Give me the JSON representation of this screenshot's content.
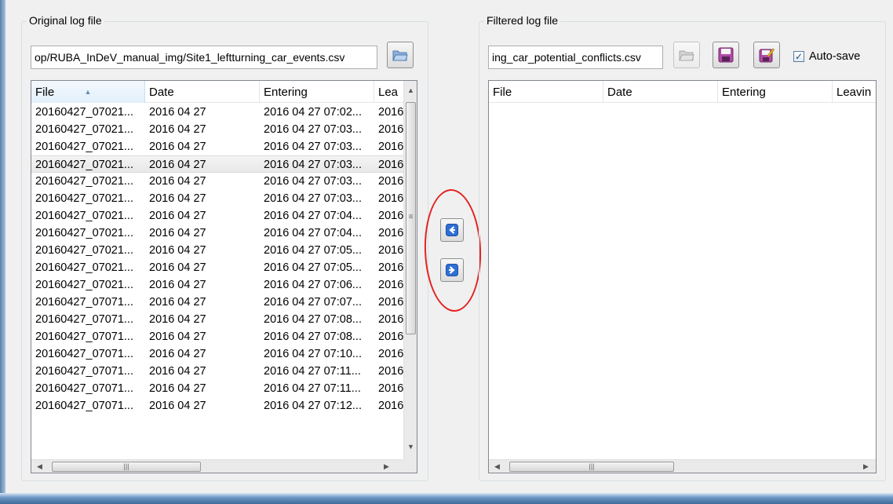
{
  "original": {
    "group_title": "Original log file",
    "path": "op/RUBA_InDeV_manual_img/Site1_leftturning_car_events.csv",
    "columns": [
      "File",
      "Date",
      "Entering",
      "Lea"
    ],
    "rows": [
      [
        "20160427_07021...",
        "2016 04 27",
        "2016 04 27 07:02...",
        "2016"
      ],
      [
        "20160427_07021...",
        "2016 04 27",
        "2016 04 27 07:03...",
        "2016"
      ],
      [
        "20160427_07021...",
        "2016 04 27",
        "2016 04 27 07:03...",
        "2016"
      ],
      [
        "20160427_07021...",
        "2016 04 27",
        "2016 04 27 07:03...",
        "2016"
      ],
      [
        "20160427_07021...",
        "2016 04 27",
        "2016 04 27 07:03...",
        "2016"
      ],
      [
        "20160427_07021...",
        "2016 04 27",
        "2016 04 27 07:03...",
        "2016"
      ],
      [
        "20160427_07021...",
        "2016 04 27",
        "2016 04 27 07:04...",
        "2016"
      ],
      [
        "20160427_07021...",
        "2016 04 27",
        "2016 04 27 07:04...",
        "2016"
      ],
      [
        "20160427_07021...",
        "2016 04 27",
        "2016 04 27 07:05...",
        "2016"
      ],
      [
        "20160427_07021...",
        "2016 04 27",
        "2016 04 27 07:05...",
        "2016"
      ],
      [
        "20160427_07021...",
        "2016 04 27",
        "2016 04 27 07:06...",
        "2016"
      ],
      [
        "20160427_07071...",
        "2016 04 27",
        "2016 04 27 07:07...",
        "2016"
      ],
      [
        "20160427_07071...",
        "2016 04 27",
        "2016 04 27 07:08...",
        "2016"
      ],
      [
        "20160427_07071...",
        "2016 04 27",
        "2016 04 27 07:08...",
        "2016"
      ],
      [
        "20160427_07071...",
        "2016 04 27",
        "2016 04 27 07:10...",
        "2016"
      ],
      [
        "20160427_07071...",
        "2016 04 27",
        "2016 04 27 07:11...",
        "2016"
      ],
      [
        "20160427_07071...",
        "2016 04 27",
        "2016 04 27 07:11...",
        "2016"
      ],
      [
        "20160427_07071...",
        "2016 04 27",
        "2016 04 27 07:12...",
        "2016"
      ]
    ],
    "hovered_row": 3,
    "sorted_column": 0
  },
  "filtered": {
    "group_title": "Filtered log file",
    "path": "ing_car_potential_conflicts.csv",
    "columns": [
      "File",
      "Date",
      "Entering",
      "Leavin"
    ],
    "autosave_label": "Auto-save",
    "autosave_checked": true
  },
  "icons": {
    "open": "folder-open-icon",
    "save": "save-icon",
    "save_as": "save-as-icon",
    "move_left": "arrow-left-icon",
    "move_right": "arrow-right-icon"
  },
  "colors": {
    "annotation_circle": "#e3221e",
    "move_button_blue": "#2f6fd6"
  }
}
